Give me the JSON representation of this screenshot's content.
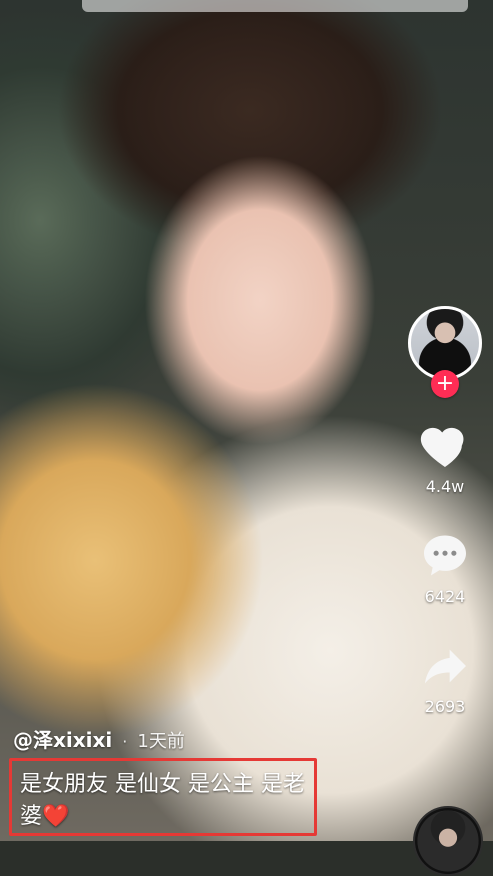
{
  "post": {
    "author_handle": "@泽xixixi",
    "separator": "·",
    "time_ago": "1天前",
    "caption": "是女朋友 是仙女 是公主 是老婆❤️"
  },
  "actions": {
    "follow_symbol": "+",
    "like_count": "4.4w",
    "comment_count": "6424",
    "share_count": "2693"
  },
  "icons": {
    "avatar": "profile-avatar",
    "follow": "plus-icon",
    "like": "heart-icon",
    "comment": "comment-bubble-icon",
    "share": "share-arrow-icon",
    "music": "music-disc-icon"
  },
  "colors": {
    "follow_button": "#ff2d55",
    "caption_highlight_border": "#e53935"
  }
}
